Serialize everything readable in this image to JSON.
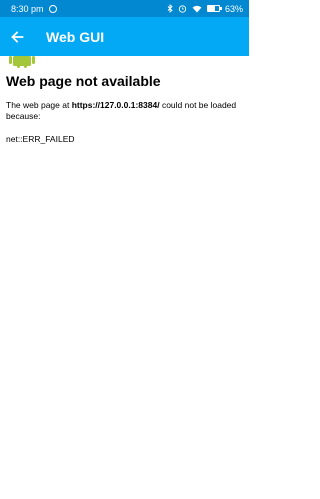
{
  "status_bar": {
    "time": "8:30 pm",
    "battery_text": "63%",
    "battery_level": 0.63,
    "icons": [
      "bluetooth-icon",
      "alarm-icon",
      "wifi-icon",
      "battery-icon"
    ]
  },
  "app_bar": {
    "title": "Web GUI",
    "back_icon": "arrow-left-icon"
  },
  "error": {
    "icon": "android-robot-icon",
    "title": "Web page not available",
    "desc_prefix": "The web page at ",
    "url": "https://127.0.0.1:8384/",
    "desc_suffix": " could not be loaded because:",
    "code": "net::ERR_FAILED"
  },
  "colors": {
    "status_bar": "#0288d1",
    "app_bar": "#03a9f4",
    "android_green": "#a4c639"
  }
}
